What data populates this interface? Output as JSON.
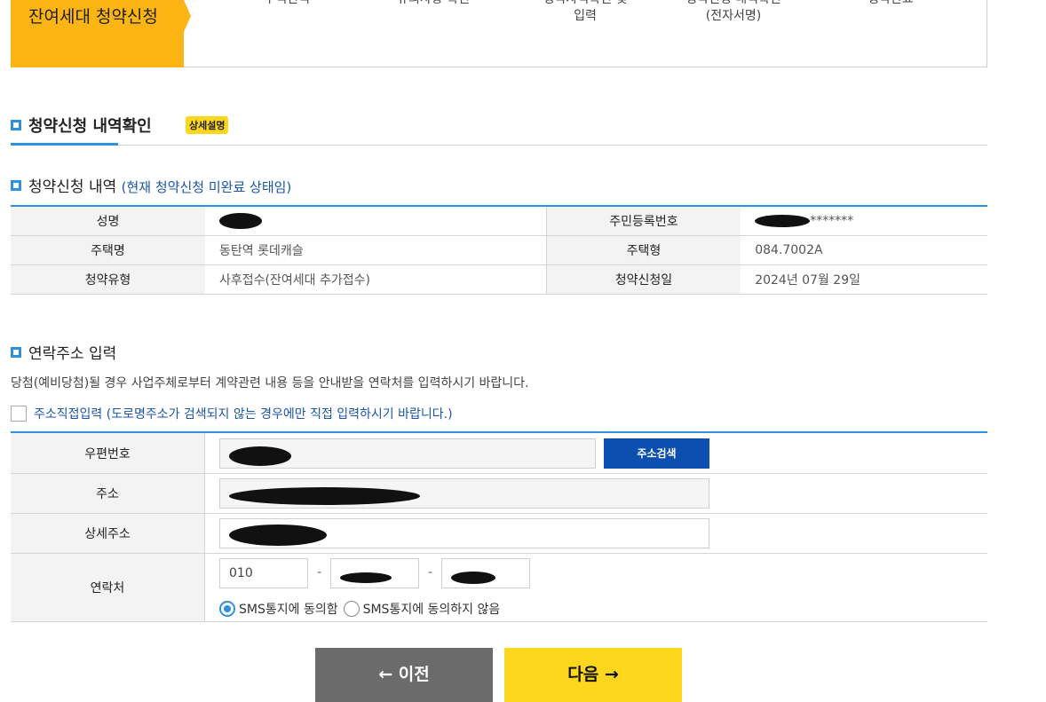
{
  "steps": {
    "active": "잔여세대 청약신청",
    "items": [
      {
        "line1": "주택선택",
        "line2": ""
      },
      {
        "line1": "유의사항 확인",
        "line2": ""
      },
      {
        "line1": "청약자격확인 및",
        "line2": "입력"
      },
      {
        "line1": "청약신청 내역확인",
        "line2": "(전자서명)"
      },
      {
        "line1": "청약완료",
        "line2": ""
      }
    ]
  },
  "section": {
    "title": "청약신청 내역확인",
    "badge": "상세설명"
  },
  "apply": {
    "title": "청약신청 내역",
    "note": "(현재 청약신청 미완료 상태임)",
    "rows": [
      {
        "h1": "성명",
        "v1": "",
        "h2": "주민등록번호",
        "v2": "*******"
      },
      {
        "h1": "주택명",
        "v1": "동탄역 롯데캐슬",
        "h2": "주택형",
        "v2": "084.7002A"
      },
      {
        "h1": "청약유형",
        "v1": "사후접수(잔여세대 추가접수)",
        "h2": "청약신청일",
        "v2": "2024년 07월 29일"
      }
    ]
  },
  "contact": {
    "title": "연락주소 입력",
    "desc": "당첨(예비당첨)될 경우 사업주체로부터 계약관련 내용 등을 안내받을 연락처를 입력하시기 바랍니다.",
    "direct_input": "주소직접입력 (도로명주소가 검색되지 않는 경우에만 직접 입력하시기 바랍니다.)",
    "zip_label": "우편번호",
    "search_button": "주소검색",
    "address_label": "주소",
    "detail_label": "상세주소",
    "phone_label": "연락처",
    "phone_prefix": "010",
    "dash": "-",
    "sms_agree": "SMS통지에 동의함",
    "sms_disagree": "SMS통지에 동의하지 않음",
    "sms_selected": "agree"
  },
  "nav": {
    "prev": "← 이전",
    "next": "다음 →"
  },
  "colors": {
    "accent_blue": "#2e91e0",
    "step_yellow": "#fcb515",
    "button_yellow": "#fdd71e",
    "search_blue": "#0d4fb0"
  }
}
